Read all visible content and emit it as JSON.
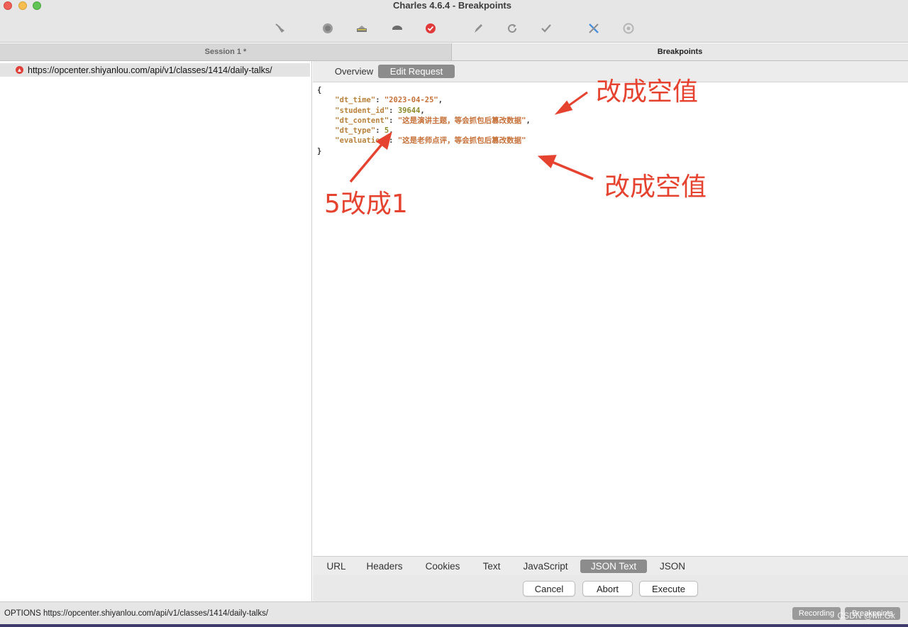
{
  "window": {
    "title": "Charles 4.6.4 - Breakpoints"
  },
  "toolbar": {
    "icons": [
      "broom-icon",
      "record-icon",
      "throttle-icon",
      "turtle-icon",
      "breakpoint-icon",
      "pen-icon",
      "refresh-icon",
      "check-icon",
      "tools-icon",
      "settings-icon"
    ]
  },
  "tabs": {
    "session": "Session 1 *",
    "breakpoints": "Breakpoints"
  },
  "tree": {
    "url": "https://opcenter.shiyanlou.com/api/v1/classes/1414/daily-talks/"
  },
  "subtabs": {
    "overview": "Overview",
    "edit_request": "Edit Request"
  },
  "json_body": {
    "open": "{",
    "close": "}",
    "fields": [
      {
        "key": "\"dt_time\"",
        "value": "\"2023-04-25\"",
        "type": "str",
        "comma": ","
      },
      {
        "key": "\"student_id\"",
        "value": "39644",
        "type": "num",
        "comma": ","
      },
      {
        "key": "\"dt_content\"",
        "value": "\"这是演讲主题，等会抓包后篡改数据\"",
        "type": "str",
        "comma": ","
      },
      {
        "key": "\"dt_type\"",
        "value": "5",
        "type": "num",
        "comma": ","
      },
      {
        "key": "\"evaluation\"",
        "value": "\"这是老师点评，等会抓包后篡改数据\"",
        "type": "str",
        "comma": ""
      }
    ]
  },
  "annotations": {
    "top_right": "改成空值",
    "mid_right": "改成空值",
    "left": "5改成1",
    "color": "#e5432f"
  },
  "view_tabs": [
    "URL",
    "Headers",
    "Cookies",
    "Text",
    "JavaScript",
    "JSON Text",
    "JSON"
  ],
  "view_tabs_active": "JSON Text",
  "actions": {
    "cancel": "Cancel",
    "abort": "Abort",
    "execute": "Execute"
  },
  "status": {
    "text": "OPTIONS https://opcenter.shiyanlou.com/api/v1/classes/1414/daily-talks/",
    "recording": "Recording",
    "breakpoints": "Breakpoints",
    "watermark": "CSDN @Mr.Gk"
  }
}
